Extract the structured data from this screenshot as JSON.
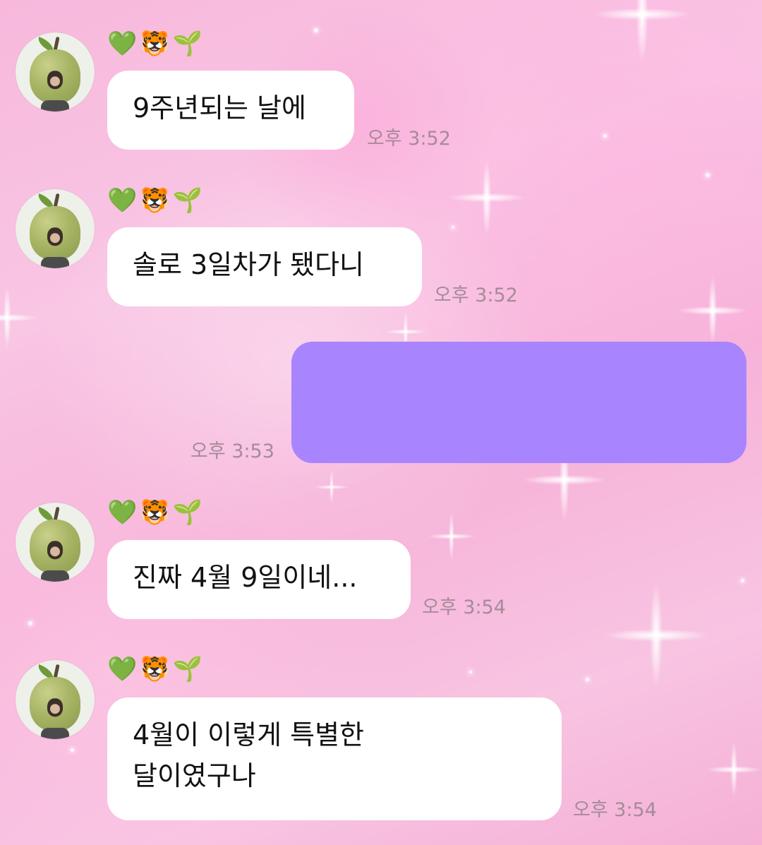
{
  "messages": [
    {
      "sender_emojis": [
        "💚",
        "🐯",
        "🌱"
      ],
      "text": "9주년되는 날에",
      "time": "오후 3:52"
    },
    {
      "sender_emojis": [
        "💚",
        "🐯",
        "🌱"
      ],
      "text": "솔로 3일차가 됐다니",
      "time": "오후 3:52"
    },
    {
      "mine": true,
      "text": "",
      "time": "오후 3:53"
    },
    {
      "sender_emojis": [
        "💚",
        "🐯",
        "🌱"
      ],
      "text": "진짜 4월 9일이네...",
      "time": "오후 3:54"
    },
    {
      "sender_emojis": [
        "💚",
        "🐯",
        "🌱"
      ],
      "text": "4월이 이렇게 특별한\n달이였구나",
      "time": "오후 3:54"
    }
  ],
  "colors": {
    "background": "#f7b8dc",
    "incoming_bubble": "#ffffff",
    "outgoing_bubble": "#a884ff",
    "timestamp": "#a58b98"
  }
}
